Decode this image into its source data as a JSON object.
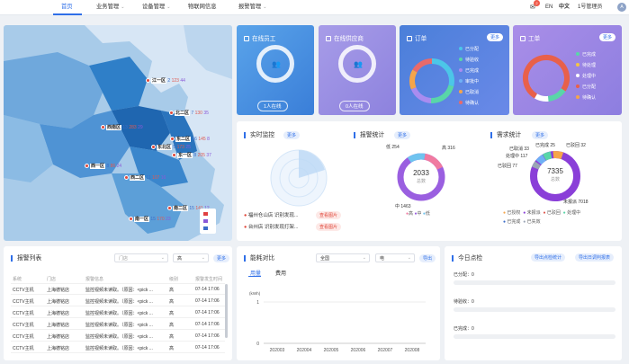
{
  "nav": {
    "home": "首页",
    "business": "业务管理",
    "device": "设备管理",
    "iot": "物联网信息",
    "alarm": "报警管理"
  },
  "topright": {
    "badge": "2",
    "lang_en": "EN",
    "lang_zh": "中文",
    "user": "1号管理员",
    "avatar_text": "A"
  },
  "colors": {
    "accent": "#2f6fe8",
    "alarm_red": "#e0473a"
  },
  "map": {
    "regions": [
      {
        "name": "江一区",
        "v1": "2",
        "v2": "123",
        "v3": "44"
      },
      {
        "name": "北二区",
        "v1": "7",
        "v2": "130",
        "v3": "35"
      },
      {
        "name": "西南区",
        "v1": "13",
        "v2": "283",
        "v3": "29"
      },
      {
        "name": "东二区",
        "v1": "16",
        "v2": "145",
        "v3": "8"
      },
      {
        "name": "东北区",
        "v1": "5",
        "v2": "173",
        "v3": "25"
      },
      {
        "name": "东一区",
        "v1": "8",
        "v2": "205",
        "v3": "37"
      },
      {
        "name": "西一区",
        "v1": "8",
        "v2": "86",
        "v3": "24"
      },
      {
        "name": "西二区",
        "v1": "11",
        "v2": "107",
        "v3": "16"
      },
      {
        "name": "南二区",
        "v1": "15",
        "v2": "141",
        "v3": "12"
      },
      {
        "name": "南一区",
        "v1": "15",
        "v2": "170",
        "v3": "23"
      }
    ]
  },
  "cards": {
    "staff": {
      "title": "在线员工",
      "status": "1人在线"
    },
    "supplier": {
      "title": "在线供应商",
      "status": "0人在线"
    },
    "orders": {
      "title": "订单",
      "more": "更多",
      "legend": [
        "已分配",
        "待验收",
        "已完成",
        "审批中",
        "已取消",
        "待确认"
      ]
    },
    "tickets": {
      "title": "工单",
      "more": "更多",
      "legend": [
        "已完成",
        "待处理",
        "处理中",
        "已分配",
        "待确认"
      ]
    }
  },
  "monitor": {
    "title": "实时监控",
    "more": "更多",
    "items": [
      {
        "text": "福州仓山店 识别发现...",
        "tag": "查看图片"
      },
      {
        "text": "台州店 识别发现打架...",
        "tag": "查看图片"
      }
    ]
  },
  "alarm_stats": {
    "title": "报警统计",
    "more": "更多",
    "total": "2033",
    "total_label": "总数",
    "low": "低 254",
    "high": "高 316",
    "mid": "中 1463",
    "legend": [
      "高",
      "中",
      "低"
    ]
  },
  "demand": {
    "title": "需求统计",
    "more": "更多",
    "total": "7335",
    "total_label": "总数",
    "labels": {
      "done": "已完成 25",
      "processed": "处理中 117",
      "rejected": "已驳回 77",
      "cancelled": "已取消 33",
      "rejected2": "已驳回 32",
      "unprocessed": "未报派 7018"
    },
    "legend": [
      "已授权",
      "未报派",
      "已驳回",
      "处理中",
      "已完成",
      "已失效"
    ]
  },
  "alarm_list": {
    "title": "报警列表",
    "select1": "门店",
    "select2": "高",
    "more": "更多",
    "headers": [
      "系统",
      "门店",
      "报警信息",
      "级别",
      "报警发生时间"
    ],
    "rows": [
      [
        "CCTV主机",
        "上海德铭店",
        "监控视频未读取。（原因：<pick ...",
        "高",
        "07-14 17:06"
      ],
      [
        "CCTV主机",
        "上海德铭店",
        "监控视频未读取。（原因：<pick ...",
        "高",
        "07-14 17:06"
      ],
      [
        "CCTV主机",
        "上海德铭店",
        "监控视频未读取。（原因：<pick ...",
        "高",
        "07-14 17:06"
      ],
      [
        "CCTV主机",
        "上海德铭店",
        "监控视频未读取。（原因：<pick ...",
        "高",
        "07-14 17:06"
      ],
      [
        "CCTV主机",
        "上海德铭店",
        "监控视频未读取。（原因：<pick ...",
        "高",
        "07-14 17:06"
      ],
      [
        "CCTV主机",
        "上海德铭店",
        "监控视频未读取。（原因：<pick ...",
        "高",
        "07-14 17:06"
      ]
    ]
  },
  "energy": {
    "title": "能耗对比",
    "select1": "全国",
    "select2": "电",
    "export": "导出",
    "tab_usage": "用量",
    "tab_cost": "费用",
    "unit": "(kWh)"
  },
  "chart_data": {
    "type": "line",
    "x": [
      "202003",
      "202004",
      "202005",
      "202006",
      "202007",
      "202008"
    ],
    "ylabel": "(kWh)",
    "yticks": [
      "1",
      "0"
    ],
    "ylim": [
      0,
      1
    ],
    "series": [
      {
        "values": [
          0,
          0,
          0,
          0,
          0,
          0
        ]
      }
    ]
  },
  "checks": {
    "title": "今日点检",
    "btn1": "导出点检统计",
    "btn2": "导出日调判报表",
    "rows": [
      "已分配：0",
      "待验收：0",
      "已完成：0"
    ]
  }
}
